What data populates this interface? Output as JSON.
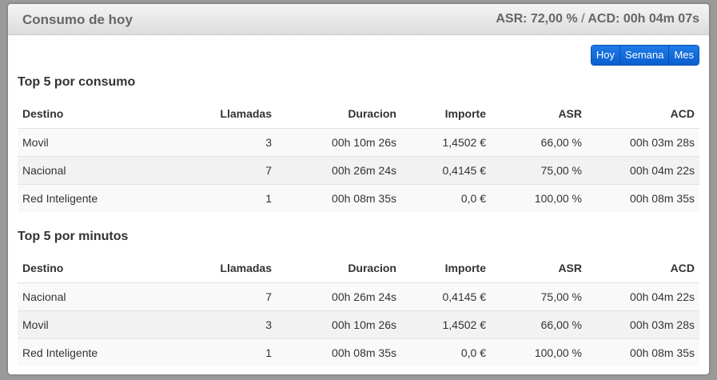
{
  "header": {
    "title": "Consumo de hoy",
    "asr_label": "ASR: 72,00 %",
    "separator": "/",
    "acd_label": "ACD: 00h 04m 07s"
  },
  "period_buttons": {
    "today": "Hoy",
    "week": "Semana",
    "month": "Mes"
  },
  "columns": [
    "Destino",
    "Llamadas",
    "Duracion",
    "Importe",
    "ASR",
    "ACD"
  ],
  "top_consumo": {
    "title": "Top 5 por consumo",
    "rows": [
      [
        "Movil",
        "3",
        "00h 10m 26s",
        "1,4502 €",
        "66,00 %",
        "00h 03m 28s"
      ],
      [
        "Nacional",
        "7",
        "00h 26m 24s",
        "0,4145 €",
        "75,00 %",
        "00h 04m 22s"
      ],
      [
        "Red Inteligente",
        "1",
        "00h 08m 35s",
        "0,0 €",
        "100,00 %",
        "00h 08m 35s"
      ]
    ]
  },
  "top_minutos": {
    "title": "Top 5 por minutos",
    "rows": [
      [
        "Nacional",
        "7",
        "00h 26m 24s",
        "0,4145 €",
        "75,00 %",
        "00h 04m 22s"
      ],
      [
        "Movil",
        "3",
        "00h 10m 26s",
        "1,4502 €",
        "66,00 %",
        "00h 03m 28s"
      ],
      [
        "Red Inteligente",
        "1",
        "00h 08m 35s",
        "0,0 €",
        "100,00 %",
        "00h 08m 35s"
      ]
    ]
  }
}
